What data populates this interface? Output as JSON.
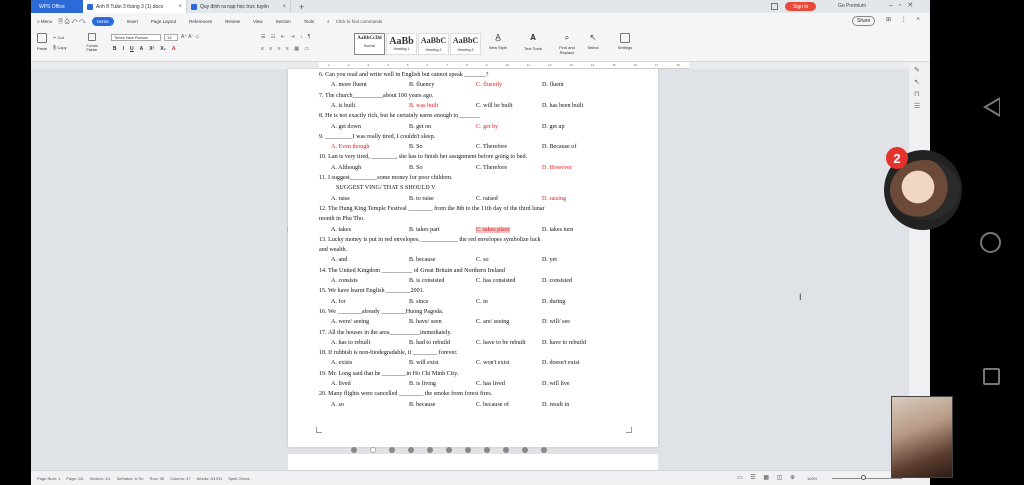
{
  "titlebar": {
    "brand": "WPS Office",
    "tabs": [
      {
        "label": "Anh 8 Tuần 3 tháng 3 (1).docx"
      },
      {
        "label": "Quy định ra nạp học trực tuyến"
      }
    ],
    "new_tab": "+",
    "sign_in": "Sign in",
    "premium": "Go Premium"
  },
  "menubar": {
    "menu": "≡ Menu",
    "items": [
      "Home",
      "Insert",
      "Page Layout",
      "References",
      "Review",
      "View",
      "Section",
      "Tools"
    ],
    "active": "Home",
    "find": "Click to find commands",
    "share": "Share"
  },
  "ribbon": {
    "paste": "Paste",
    "cut": "Cut",
    "copy": "Copy",
    "format_painter": "Format Painter",
    "font_name": "Times New Roman",
    "font_size": "13",
    "styles": [
      {
        "preview": "AaBbCcDd",
        "name": "Normal"
      },
      {
        "preview": "AaBb",
        "name": "Heading 1"
      },
      {
        "preview": "AaBbC",
        "name": "Heading 2"
      },
      {
        "preview": "AaBbC",
        "name": "Heading 3"
      }
    ],
    "new_style": "New Style",
    "text_tools": "Text Tools",
    "find_replace": "Find and Replace",
    "select": "Select",
    "settings": "Settings"
  },
  "document": {
    "questions": [
      {
        "n": "6.",
        "text": "Can you read and write well in English but cannot speak _______?",
        "opts": [
          "A. more fluent",
          "B. fluency",
          "C. fluently",
          "D. fluent"
        ],
        "red": 2
      },
      {
        "n": "7.",
        "text": "The church__________about 100 years ago.",
        "opts": [
          "A. is built",
          "B. was built",
          "C. will be built",
          "D. has been built"
        ],
        "red": 1
      },
      {
        "n": "8.",
        "text": "He is not exactly rich, but he certainly earns enough to_______",
        "opts": [
          "A. get down",
          "B. get on",
          "C. get by",
          "D. get up"
        ],
        "red": 2
      },
      {
        "n": "9.",
        "text": "_________I was really tired, I couldn't sleep.",
        "opts": [
          "A. Even though",
          "B. So",
          "C. Therefore",
          "D. Because of"
        ],
        "red": 0
      },
      {
        "n": "10.",
        "text": "Lan is very tired, ________, she has to finish her assignment before going to bed.",
        "opts": [
          "A. Although",
          "B. So",
          "C. Therefore",
          "D. However"
        ],
        "red": 3
      },
      {
        "n": "11.",
        "text": "I suggest_________some money for poor children.",
        "extra": "SUGGEST VING/ THAT S SHOULD V",
        "opts": [
          "A. raise",
          "B. to raise",
          "C. raised",
          "D. raising"
        ],
        "red": 3
      },
      {
        "n": "12.",
        "text": "The Hung King Temple Festival ________ from the 8th to the 11th day of the third lunar",
        "cont": "month in Phu Tho.",
        "opts": [
          "A. takes",
          "B. takes part",
          "C. takes place",
          "D. takes turn"
        ],
        "red": 2
      },
      {
        "n": "13.",
        "text": "Lucky money is put in red envelopes, ____________ the red envelopes symbolize luck",
        "cont": "and wealth.",
        "opts": [
          "A. and",
          "B. because",
          "C. so",
          "D. yet"
        ],
        "red": -1
      },
      {
        "n": "14.",
        "text": "The United Kingdom __________ of Great Britain and Northern Ireland",
        "opts": [
          "A. consists",
          "B. is consisted",
          "C. has consisted",
          "D. consisted"
        ],
        "red": -1
      },
      {
        "n": "15.",
        "text": "We have learnt English ________2001.",
        "opts": [
          "A. for",
          "B. since",
          "C. in",
          "D. during"
        ],
        "red": -1
      },
      {
        "n": "16.",
        "text": "We ________already ________Huong Pagoda.",
        "opts": [
          "A. were/ seeing",
          "B. have/ seen",
          "C. are/ seeing",
          "D. will/ see"
        ],
        "red": -1
      },
      {
        "n": "17.",
        "text": "All the houses in the area__________immediately.",
        "opts": [
          "A. has to rebuilt",
          "B. had to rebuild",
          "C. have to be rebuilt",
          "D. have to rebuild"
        ],
        "red": -1
      },
      {
        "n": "18.",
        "text": "If rubbish is non-biodegradable, it ________ forever.",
        "opts": [
          "A. exists",
          "B. will exist",
          "C. won't exist",
          "D. doesn't exist"
        ],
        "red": -1
      },
      {
        "n": "19.",
        "text": "Mr. Long said that he ________in Ho Chi Minh City.",
        "opts": [
          "A. lived",
          "B. is living",
          "C. has lived",
          "D. will live"
        ],
        "red": -1
      },
      {
        "n": "20.",
        "text": "Many flights were cancelled ________ the smoke from forest fires.",
        "opts": [
          "A. so",
          "B. because",
          "C. because of",
          "D. result in"
        ],
        "red": -1
      }
    ]
  },
  "statusbar": {
    "page_num": "Page Num: 1",
    "page": "Page: 1/6",
    "section": "Section: 1/1",
    "setvalue": "SetValue: 6.7in",
    "row": "Row: 35",
    "column": "Column: 47",
    "words": "Words: 3/1911",
    "spell": "Spell Check",
    "zoom": "100%"
  },
  "overlay": {
    "badge": "2"
  }
}
